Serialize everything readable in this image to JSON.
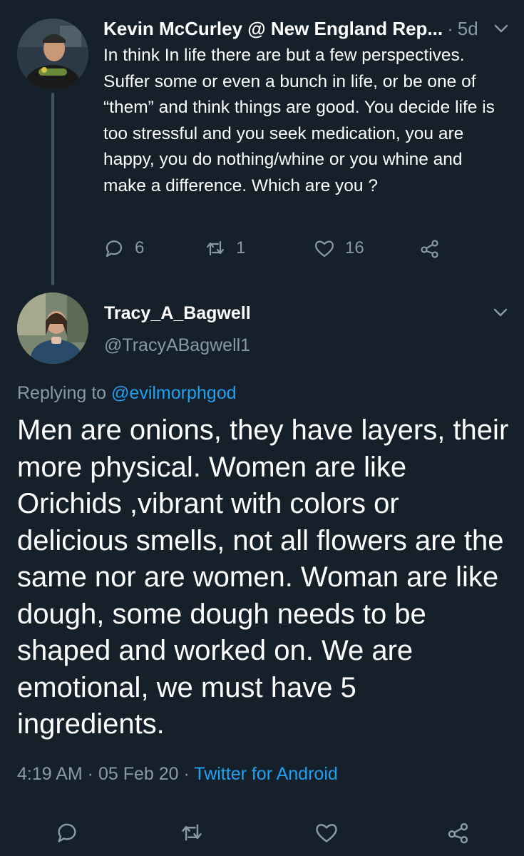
{
  "parent_tweet": {
    "author": "Kevin McCurley @ New England Rep...",
    "separator": "·",
    "time": "5d",
    "text": "In think In life there are but a few perspectives. Suffer some or even a bunch in life, or be one of “them” and think things are good. You decide life is too stressful and you seek medication, you are happy, you do nothing/whine or you whine and make a difference. Which are you ?",
    "replies": "6",
    "retweets": "1",
    "likes": "16"
  },
  "main_tweet": {
    "display_name": "Tracy_A_Bagwell",
    "handle": "@TracyABagwell1",
    "replying_label": "Replying to ",
    "replying_to": "@evilmorphgod",
    "text": "Men are onions, they have layers, their more physical.  Women are like Orichids ,vibrant with colors or delicious smells, not all flowers are the same nor are women. Woman are like dough, some dough needs to be shaped and worked on. We are emotional, we must have 5 ingredients.",
    "timestamp": "4:19 AM · 05 Feb 20 · ",
    "source": "Twitter for Android"
  },
  "icons": {
    "reply": "reply-icon",
    "retweet": "retweet-icon",
    "like": "heart-icon",
    "share": "share-icon",
    "more": "chevron-down-icon"
  },
  "colors": {
    "background": "#15202b",
    "text": "#ffffff",
    "secondary": "#8899a6",
    "link": "#1da1f2",
    "thread_line": "#3d5466"
  }
}
